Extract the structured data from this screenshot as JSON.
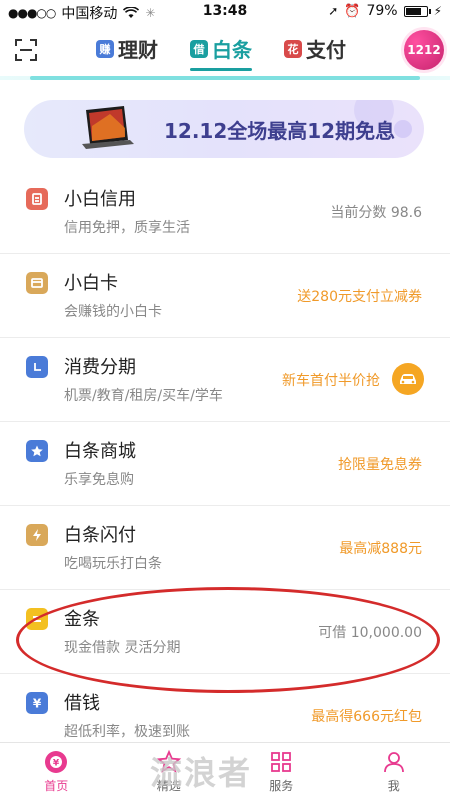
{
  "status_bar": {
    "carrier": "中国移动",
    "time": "13:48",
    "battery_percent": "79%",
    "battery_level": 0.79
  },
  "header": {
    "tabs": [
      {
        "badge": "赚",
        "label": "理财",
        "color": "#4a7bd8",
        "active": false
      },
      {
        "badge": "借",
        "label": "白条",
        "color": "#1a9fa0",
        "active": true
      },
      {
        "badge": "花",
        "label": "支付",
        "color": "#d84a4a",
        "active": false
      }
    ],
    "promo_bubble": "1212"
  },
  "banner": {
    "text": "12.12全场最高12期免息"
  },
  "list": [
    {
      "icon": "credit-icon",
      "icon_color": "#e66a5a",
      "title": "小白信用",
      "subtitle": "信用免押，质享生活",
      "right": "当前分数 98.6",
      "right_style": "gray"
    },
    {
      "icon": "card-icon",
      "icon_color": "#d9a85a",
      "title": "小白卡",
      "subtitle": "会赚钱的小白卡",
      "right": "送280元支付立减券",
      "right_style": "orange"
    },
    {
      "icon": "clock-icon",
      "icon_color": "#4a7bd8",
      "title": "消费分期",
      "subtitle": "机票/教育/租房/买车/学车",
      "right": "新车首付半价抢",
      "right_style": "orange"
    },
    {
      "icon": "star-icon",
      "icon_color": "#4a7bd8",
      "title": "白条商城",
      "subtitle": "乐享免息购",
      "right": "抢限量免息券",
      "right_style": "orange"
    },
    {
      "icon": "lightning-icon",
      "icon_color": "#d9a85a",
      "title": "白条闪付",
      "subtitle": "吃喝玩乐打白条",
      "right": "最高减888元",
      "right_style": "orange"
    },
    {
      "icon": "gold-icon",
      "icon_color": "#f3c021",
      "title": "金条",
      "subtitle": "现金借款 灵活分期",
      "right": "可借 10,000.00",
      "right_style": "gray"
    },
    {
      "icon": "yen-icon",
      "icon_color": "#4a7bd8",
      "title": "借钱",
      "subtitle": "超低利率，极速到账",
      "right": "最高得666元红包",
      "right_style": "orange"
    }
  ],
  "bottom_nav": [
    {
      "label": "首页",
      "icon": "home-icon",
      "active": true
    },
    {
      "label": "精选",
      "icon": "star-outline-icon",
      "active": false
    },
    {
      "label": "服务",
      "icon": "grid-icon",
      "active": false
    },
    {
      "label": "我",
      "icon": "person-icon",
      "active": false
    }
  ],
  "watermark": "流浪者"
}
